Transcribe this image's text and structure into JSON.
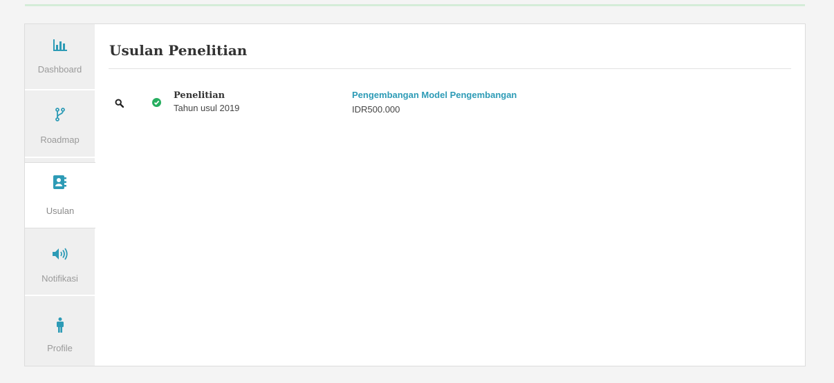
{
  "colors": {
    "accent": "#2d9bb6",
    "success": "#27ae60",
    "sidebar_bg": "#efefef"
  },
  "sidebar": {
    "items": [
      {
        "label": "Dashboard",
        "icon": "bar-chart-icon",
        "active": false
      },
      {
        "label": "Roadmap",
        "icon": "code-fork-icon",
        "active": false
      },
      {
        "label": "Usulan",
        "icon": "address-book-icon",
        "active": true
      },
      {
        "label": "Notifikasi",
        "icon": "volume-up-icon",
        "active": false
      },
      {
        "label": "Profile",
        "icon": "male-icon",
        "active": false
      }
    ]
  },
  "main": {
    "title": "Usulan Penelitian",
    "rows": [
      {
        "type": "Penelitian",
        "year": "Tahun usul 2019",
        "title": "Pengembangan Model Pengembangan",
        "amount": "IDR500.000",
        "status_icon": "check-circle-icon",
        "action_icon": "search-icon"
      }
    ]
  }
}
